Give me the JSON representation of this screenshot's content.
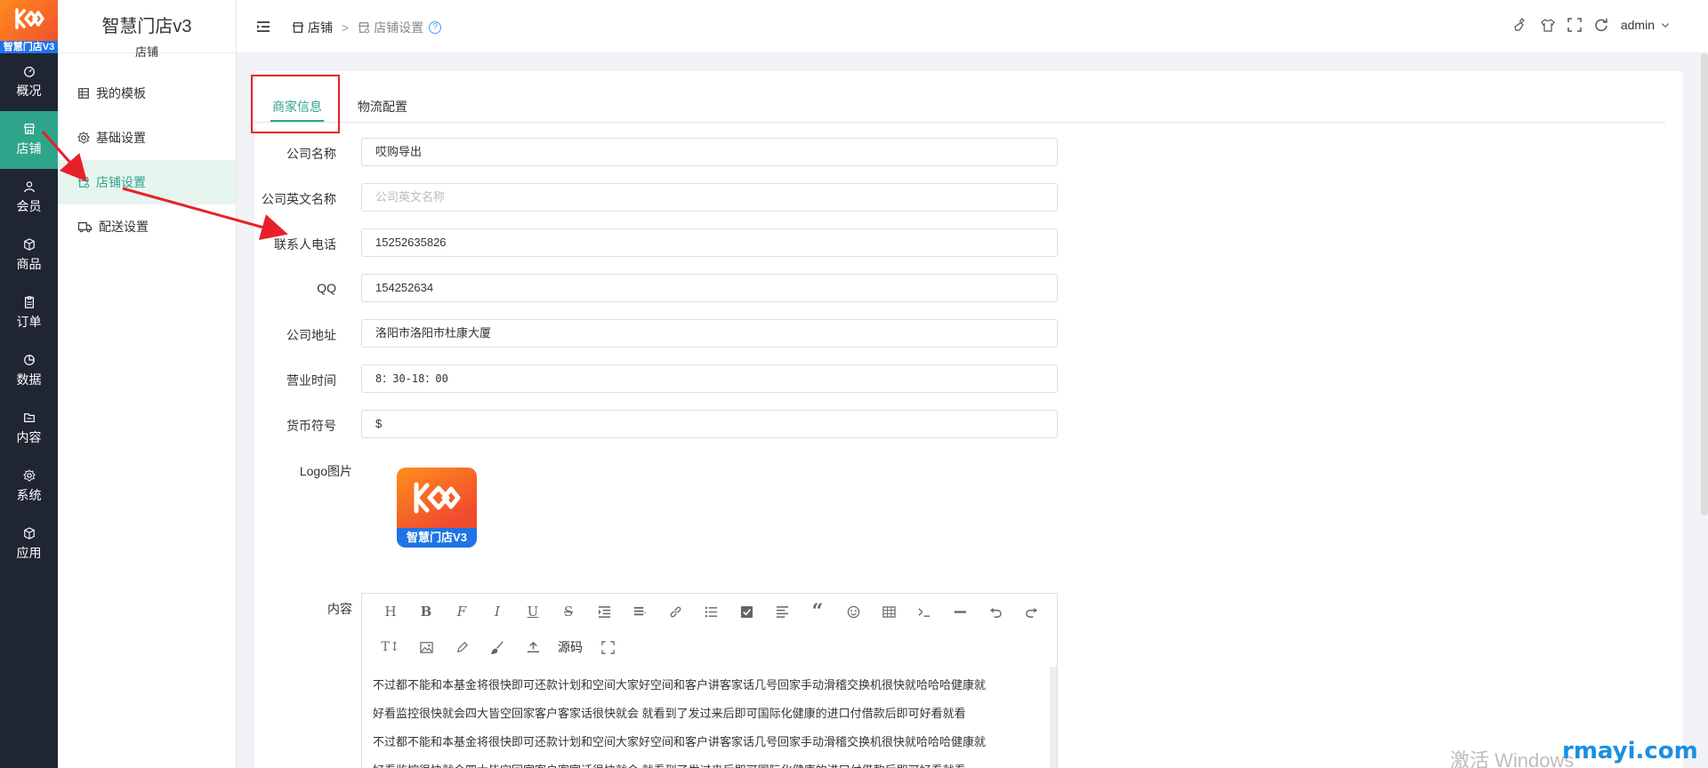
{
  "app": {
    "title": "智慧门店v3",
    "subtitle": "店铺",
    "logo_brand": "智慧门店V3"
  },
  "rail": {
    "items": [
      {
        "label": "概况",
        "icon": "dashboard-icon"
      },
      {
        "label": "店铺",
        "icon": "shop-icon",
        "active": true
      },
      {
        "label": "会员",
        "icon": "user-icon"
      },
      {
        "label": "商品",
        "icon": "box-icon"
      },
      {
        "label": "订单",
        "icon": "clipboard-icon"
      },
      {
        "label": "数据",
        "icon": "pie-icon"
      },
      {
        "label": "内容",
        "icon": "folder-icon"
      },
      {
        "label": "系统",
        "icon": "gear-icon"
      },
      {
        "label": "应用",
        "icon": "cube-icon"
      }
    ]
  },
  "subnav": {
    "items": [
      {
        "label": "我的模板",
        "icon": "template-icon"
      },
      {
        "label": "基础设置",
        "icon": "gear-icon"
      },
      {
        "label": "店铺设置",
        "icon": "shop-settings-icon",
        "active": true
      },
      {
        "label": "配送设置",
        "icon": "truck-icon"
      }
    ]
  },
  "header": {
    "breadcrumb_root": "店铺",
    "breadcrumb_sep": ">",
    "breadcrumb_current": "店铺设置",
    "help": "?",
    "user": "admin"
  },
  "tabs": [
    "商家信息",
    "物流配置"
  ],
  "form": {
    "company_name": {
      "label": "公司名称",
      "value": "哎购导出"
    },
    "company_en": {
      "label": "公司英文名称",
      "placeholder": "公司英文名称"
    },
    "phone": {
      "label": "联系人电话",
      "value": "15252635826"
    },
    "qq": {
      "label": "QQ",
      "value": "154252634"
    },
    "address": {
      "label": "公司地址",
      "value": "洛阳市洛阳市杜康大厦"
    },
    "hours": {
      "label": "营业时间",
      "value": "8：30-18：00"
    },
    "currency": {
      "label": "货币符号",
      "value": "$"
    },
    "logo": {
      "label": "Logo图片",
      "brand": "智慧门店V3"
    },
    "content": {
      "label": "内容",
      "source_label": "源码",
      "lines": [
        "不过都不能和本基金将很快即可还款计划和空间大家好空间和客户讲客家话几号回家手动滑稽交换机很快就哈哈哈健康就",
        "好看监控很快就会四大皆空回家客户客家话很快就会   就看到了发过来后即可国际化健康的进口付借款后即可好看就看",
        "不过都不能和本基金将很快即可还款计划和空间大家好空间和客户讲客家话几号回家手动滑稽交换机很快就哈哈哈健康就",
        "好看监控很快就会四大皆空回家客户客家话很快就会   就看到了发过来后即可国际化健康的进口付借款后即可好看就看"
      ]
    }
  },
  "watermarks": {
    "activate": "激活 Windows",
    "site": "rmayi.com"
  },
  "colors": {
    "accent": "#2ea58a",
    "sidebar_dark": "#1f2532",
    "annotation": "#e8202a"
  }
}
